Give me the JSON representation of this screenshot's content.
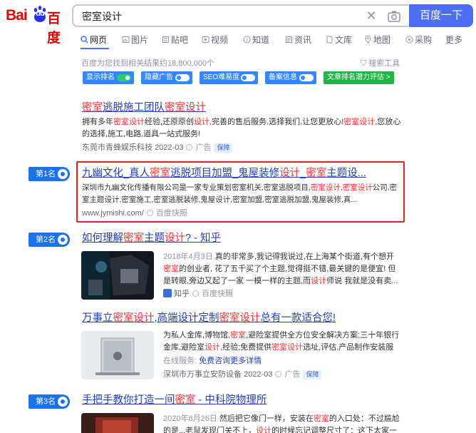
{
  "header": {
    "logo_latin": "Bai",
    "logo_du": "du",
    "logo_cn": "百度",
    "query": "密室设计",
    "search_button": "百度一下"
  },
  "tabs": [
    {
      "label": "网页",
      "icon": "search-icon"
    },
    {
      "label": "图片",
      "icon": "image-icon"
    },
    {
      "label": "贴吧",
      "icon": "tieba-icon"
    },
    {
      "label": "视频",
      "icon": "video-icon"
    },
    {
      "label": "知道",
      "icon": "question-icon"
    },
    {
      "label": "资讯",
      "icon": "news-icon"
    },
    {
      "label": "文库",
      "icon": "doc-icon"
    },
    {
      "label": "地图",
      "icon": "map-icon"
    },
    {
      "label": "采购",
      "icon": "purchase-icon"
    },
    {
      "label": "更多",
      "icon": ""
    }
  ],
  "result_count": "百度为您找到相关结果约18,800,000个",
  "search_tools": "搜索工具",
  "toolbar": [
    {
      "label": "显示排名",
      "state": "on"
    },
    {
      "label": "隐藏广告",
      "state": "off"
    },
    {
      "label": "SEO难易度",
      "state": "off"
    },
    {
      "label": "备案信息",
      "state": "off"
    },
    {
      "label": "文章排名潜力评估 >",
      "state": ""
    }
  ],
  "results": [
    {
      "rank": "",
      "title_parts": [
        "",
        "密室",
        "逃脱施工团队",
        "密室设计",
        ""
      ],
      "desc_html_parts": [
        "拥有多年",
        "密室设计",
        "经验,还原原创",
        "设计",
        ",完善的售后服务.选择我们,让您更放心!",
        "密室设计",
        ",您放心的选择,施工,电路,道具一站式服务!"
      ],
      "source": "东莞市青蜂娱乐科技",
      "date": "2022-03",
      "ad": "广告",
      "badge": "保障"
    },
    {
      "rank": "第1名",
      "title_parts": [
        "九幽文化_真人",
        "密室",
        "逃脱项目加盟_鬼屋装修",
        "设计",
        "_",
        "密室",
        "主题设..."
      ],
      "desc_html_parts": [
        "深圳市九幽文化传播有限公司是一家专业策划密室机关,密室逃脱项目,",
        "密室设计",
        ",",
        "密室设计",
        "公司,密室主题设计,密室施工,密室逃脱装修,鬼屋设计,密室加盟,密室逃脱加盟,鬼屋装修,真..."
      ],
      "url": "www.jymishi.com/",
      "snapshot": "百度快照"
    },
    {
      "rank": "第2名",
      "title_parts": [
        "如何理解",
        "密室",
        "主题",
        "设计",
        "? - 知乎"
      ],
      "date_prefix": "2018年4月3日",
      "desc_html_parts": [
        "真的非常多,我记得我说过,在上海某个街道,有个想开",
        "密室",
        "的创业者, 花了五千买了个主题,觉得挺不错,最关键的是便宜! 但是转眼,旁边又起了一家 一模一样的主题,而",
        "设计",
        "师说 我就是没有卖..."
      ],
      "source": "知乎",
      "snapshot": "百度快照"
    },
    {
      "rank": "",
      "title_parts": [
        "万事立",
        "密室设计",
        ",高端设计定制",
        "密室设计",
        "总有一款适合您!"
      ],
      "desc_html_parts": [
        "为私人金库,博物馆,",
        "密室",
        ",避险室提供全方位安全解决方案;三十年银行金库,避险室",
        "设计",
        ",经验;免费提供",
        "密室设计",
        "选址,评估,产品制作安装服务."
      ],
      "online_label": "在线服务:",
      "online_link": "免费咨询更多详情",
      "source": "深圳市万事立安防设备",
      "date": "2022-03",
      "ad": "广告",
      "badge": "保障"
    },
    {
      "rank": "第3名",
      "title_parts": [
        "手把手教你打造一间",
        "密室",
        " - 中科院物理所"
      ],
      "date_prefix": "2020年8月26日",
      "desc_html_parts": [
        "然后把它像门一样，安装在",
        "密室",
        "的入口处：不过尴尬的是...老鼠发现门关不上，",
        "设计",
        "的时候忘记调整尺寸了：这下太家一眼就能"
      ]
    }
  ]
}
